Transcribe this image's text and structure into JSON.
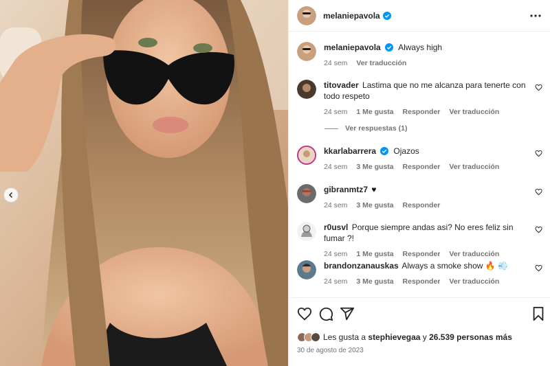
{
  "post": {
    "username": "melaniepavola",
    "caption": "Always high",
    "caption_age": "24 sem",
    "see_translation": "Ver traducción"
  },
  "comments": [
    {
      "user": "titovader",
      "text": "Lastima que no me alcanza para tenerte con todo respeto",
      "age": "24 sem",
      "likes": "1 Me gusta",
      "reply": "Responder",
      "translate": "Ver traducción",
      "replies_label": "Ver respuestas (1)"
    },
    {
      "user": "kkarlabarrera",
      "text": "Ojazos",
      "age": "24 sem",
      "likes": "3 Me gusta",
      "reply": "Responder",
      "translate": "Ver traducción",
      "verified": true
    },
    {
      "user": "gibranmtz7",
      "text": "♥",
      "age": "24 sem",
      "likes": "3 Me gusta",
      "reply": "Responder"
    },
    {
      "user": "r0usvl",
      "text": "Porque siempre andas asi? No eres feliz sin fumar ?!",
      "age": "24 sem",
      "likes": "1 Me gusta",
      "reply": "Responder",
      "translate": "Ver traducción"
    },
    {
      "user": "brandonzanauskas",
      "text": "Always a smoke show 🔥 💨",
      "age": "24 sem",
      "likes": "3 Me gusta",
      "reply": "Responder",
      "translate": "Ver traducción"
    }
  ],
  "likes_line": {
    "prefix": "Les gusta a",
    "user": "stephievegaa",
    "joiner": "y",
    "count": "26.539 personas más"
  },
  "date": "30 de agosto de 2023",
  "colors": {
    "verified": "#0095f6",
    "text": "#262626",
    "muted": "#737373"
  },
  "icons": [
    "more-icon",
    "verified-icon",
    "heart-icon",
    "comment-icon",
    "share-icon",
    "bookmark-icon",
    "chevron-left-icon"
  ]
}
